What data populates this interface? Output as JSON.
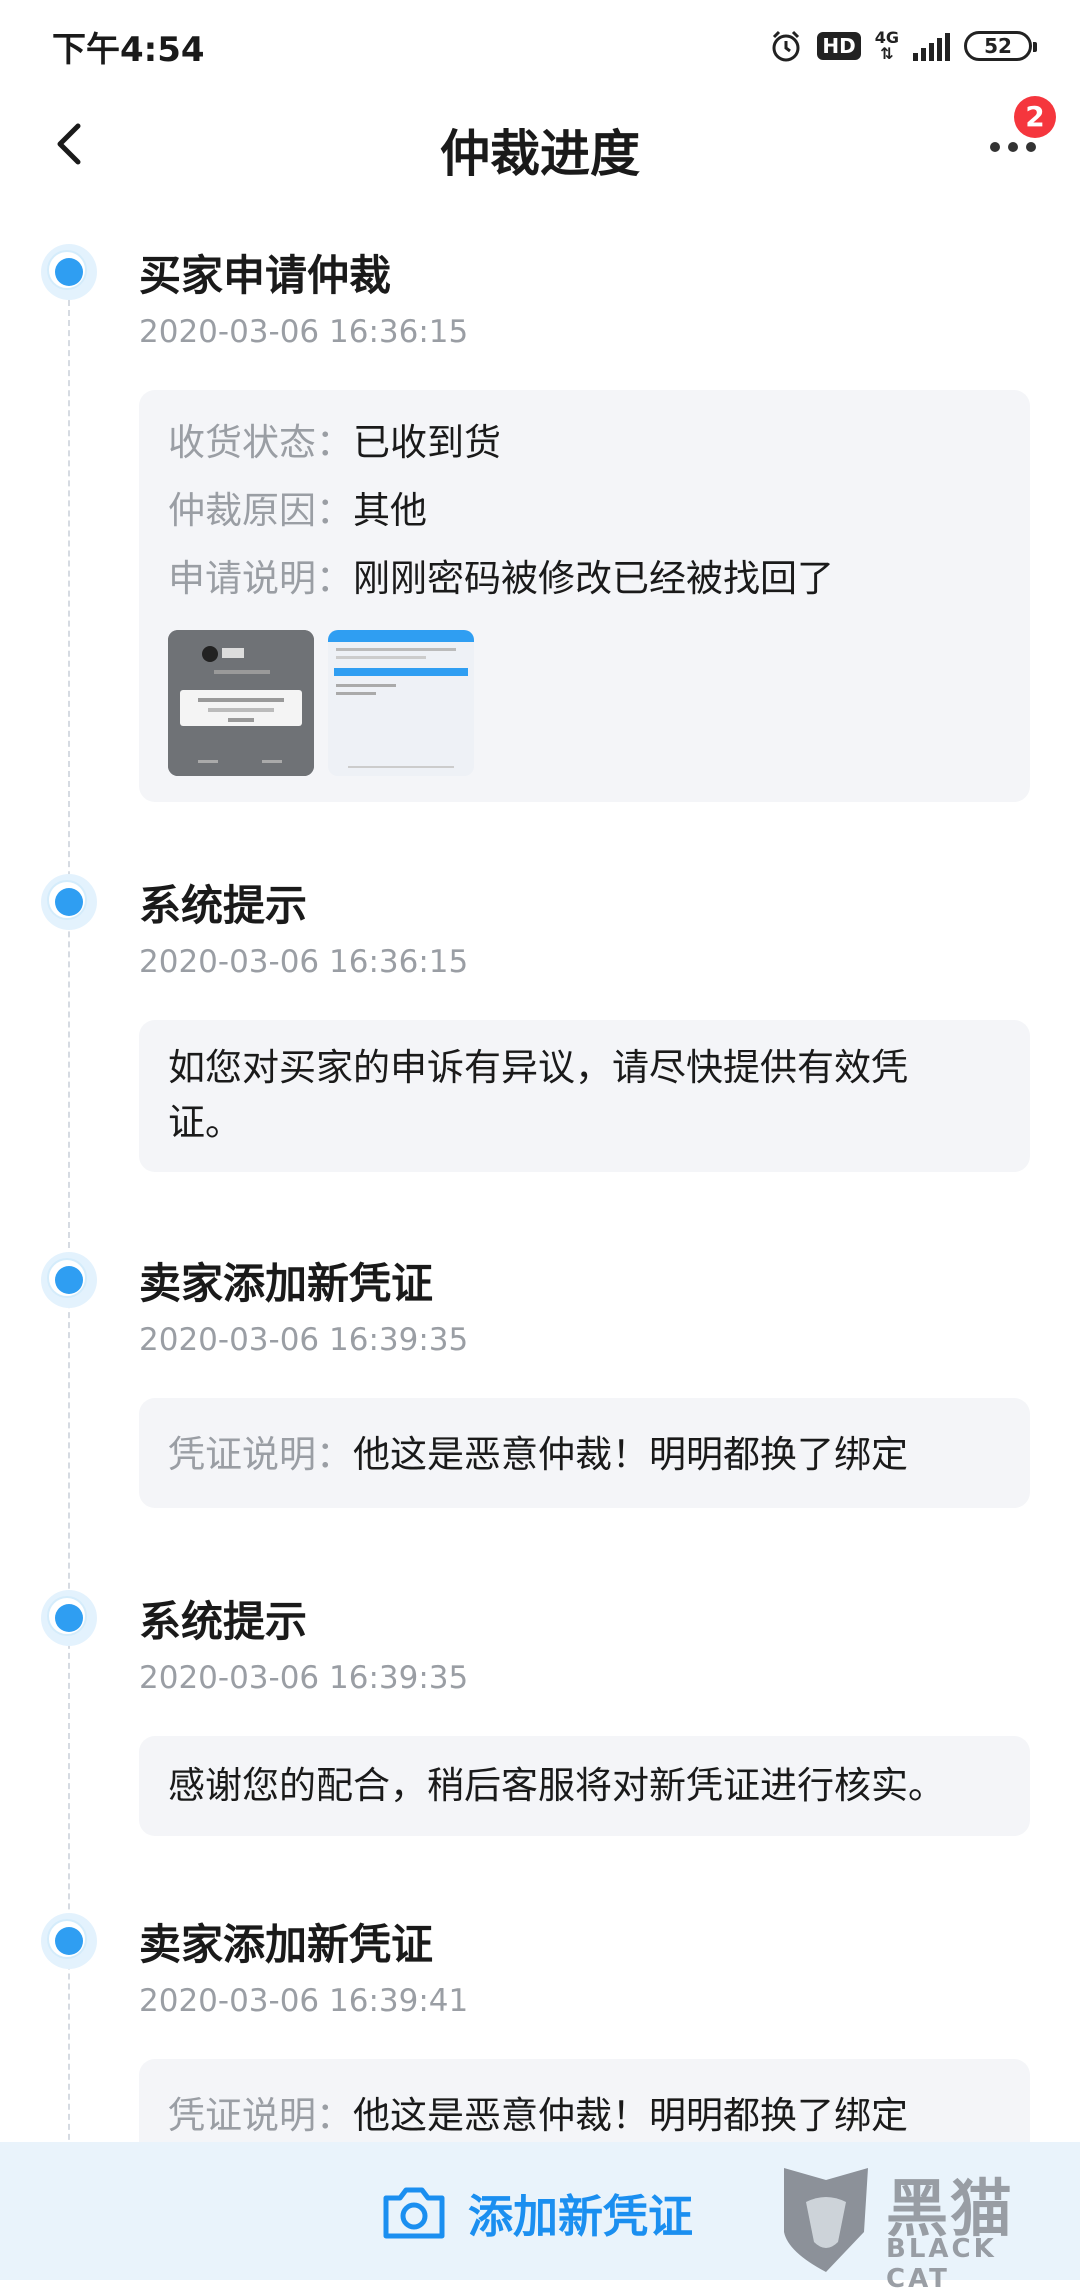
{
  "status_bar": {
    "time": "下午4:54",
    "hd_label": "HD",
    "network": "4G",
    "battery": "52"
  },
  "header": {
    "title": "仲裁进度",
    "badge_count": "2"
  },
  "events": [
    {
      "title": "买家申请仲裁",
      "time": "2020-03-06 16:36:15",
      "fields": [
        {
          "key": "收货状态：",
          "value": "已收到货"
        },
        {
          "key": "仲裁原因：",
          "value": "其他"
        },
        {
          "key": "申请说明：",
          "value": "刚刚密码被修改已经被找回了"
        }
      ]
    },
    {
      "title": "系统提示",
      "time": "2020-03-06 16:36:15",
      "text": "如您对买家的申诉有异议，请尽快提供有效凭证。"
    },
    {
      "title": "卖家添加新凭证",
      "time": "2020-03-06 16:39:35",
      "fields": [
        {
          "key": "凭证说明：",
          "value": "他这是恶意仲裁！明明都换了绑定"
        }
      ]
    },
    {
      "title": "系统提示",
      "time": "2020-03-06 16:39:35",
      "text": "感谢您的配合，稍后客服将对新凭证进行核实。"
    },
    {
      "title": "卖家添加新凭证",
      "time": "2020-03-06 16:39:41",
      "fields": [
        {
          "key": "凭证说明：",
          "value": "他这是恶意仲裁！明明都换了绑定"
        }
      ]
    }
  ],
  "bottom_bar": {
    "add_label": "添加新凭证"
  },
  "watermark": {
    "cn": "黑猫",
    "en": "BLACK CAT"
  },
  "icons": {
    "back": "chevron-left-icon",
    "more": "more-dots-icon",
    "camera": "camera-icon"
  },
  "colors": {
    "accent": "#1b8ff0",
    "badge": "#f5363d",
    "card_bg": "#f4f5f8"
  }
}
